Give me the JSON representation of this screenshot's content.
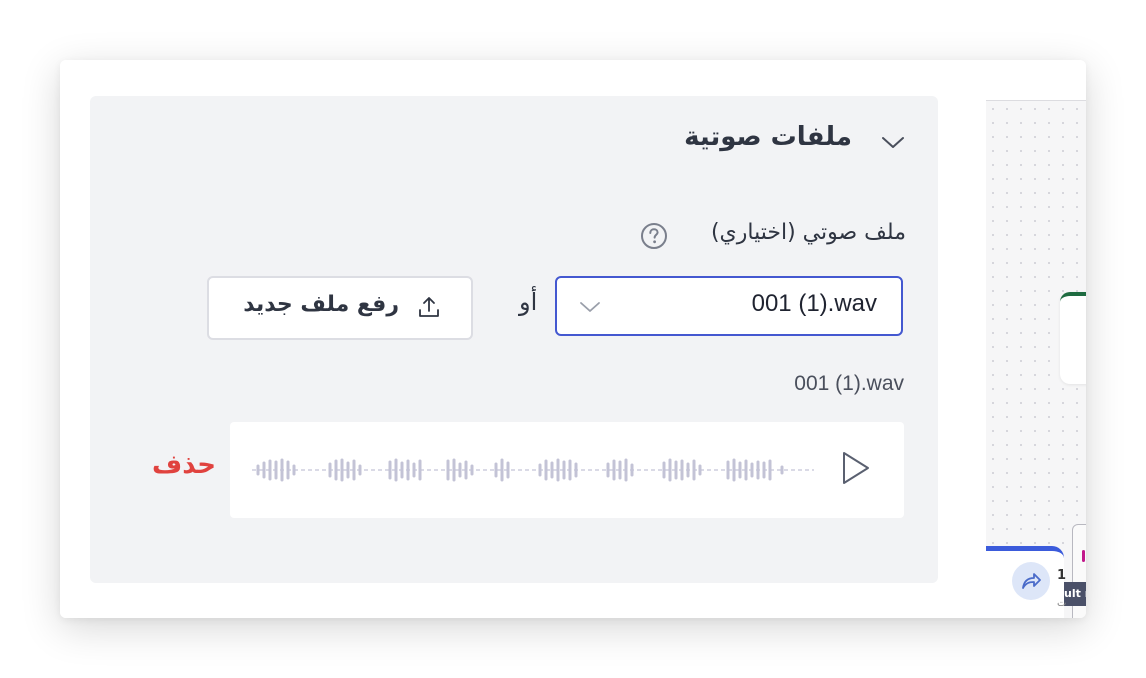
{
  "section": {
    "title": "ملفات صوتية",
    "collapse_icon": "chevron-down-icon"
  },
  "audio_field": {
    "label": "ملف صوتي (اختياري)",
    "help_icon": "question-circle-icon",
    "selected_file": "001 (1).wav",
    "select_icon": "chevron-down-icon",
    "or_text": "أو",
    "upload_label": "رفع ملف جديد",
    "upload_icon": "upload-icon"
  },
  "current_file": {
    "name": "001 (1).wav",
    "play_icon": "play-icon",
    "waveform_icon": "waveform-icon",
    "delete_label": "حذف"
  },
  "background_canvas": {
    "node_number": "1",
    "node_tag": "ult n",
    "node_sub": "ت",
    "share_icon": "share-icon"
  },
  "colors": {
    "accent": "#4458d0",
    "danger": "#e0423e",
    "panel_bg": "#f2f3f5",
    "waveform": "#c3c3d6",
    "node_blue": "#3b5bdb",
    "node_green": "#1e6b40"
  }
}
